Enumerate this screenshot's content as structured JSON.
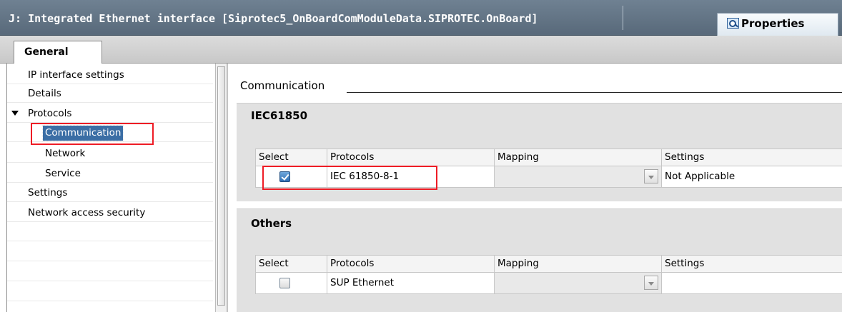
{
  "window": {
    "title": "J: Integrated Ethernet interface [Siprotec5_OnBoardComModuleData.SIPROTEC.OnBoard]",
    "properties_tab": "Properties"
  },
  "tabs": [
    {
      "label": "General",
      "active": true
    }
  ],
  "sidebar": {
    "items": [
      {
        "label": "IP interface settings"
      },
      {
        "label": "Details"
      },
      {
        "label": "Protocols",
        "expanded": true
      },
      {
        "label": "Communication",
        "selected": true
      },
      {
        "label": "Network"
      },
      {
        "label": "Service"
      },
      {
        "label": "Settings"
      },
      {
        "label": "Network access security"
      }
    ]
  },
  "main": {
    "section_title": "Communication",
    "groups": [
      {
        "title": "IEC61850",
        "columns": [
          "Select",
          "Protocols",
          "Mapping",
          "Settings"
        ],
        "rows": [
          {
            "selected": true,
            "protocol": "IEC 61850-8-1",
            "mapping": "",
            "settings": "Not Applicable"
          }
        ]
      },
      {
        "title": "Others",
        "columns": [
          "Select",
          "Protocols",
          "Mapping",
          "Settings"
        ],
        "rows": [
          {
            "selected": false,
            "protocol": "SUP Ethernet",
            "mapping": "",
            "settings": ""
          }
        ]
      }
    ]
  },
  "colors": {
    "title_bar": "#58697a",
    "selection": "#3b6ea5",
    "highlight_box": "#ee1c25",
    "group_background": "#e1e1e1"
  },
  "icons": [
    "properties-icon",
    "expand-caret-icon",
    "checkbox-checked",
    "checkbox-unchecked",
    "dropdown-arrow-icon"
  ]
}
